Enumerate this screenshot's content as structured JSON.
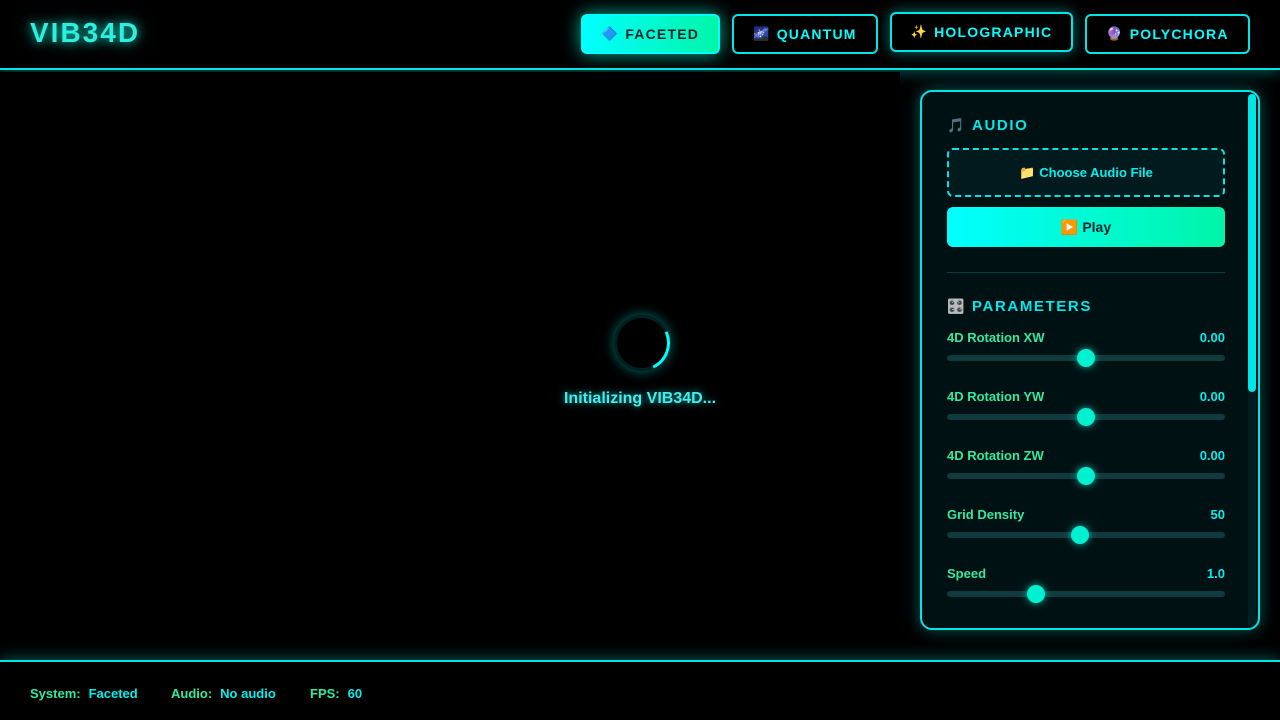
{
  "app": {
    "title": "VIB34D"
  },
  "systems": [
    {
      "icon": "🔷",
      "icon_name": "diamond-icon",
      "label": "FACETED",
      "active": true
    },
    {
      "icon": "🌌",
      "icon_name": "galaxy-icon",
      "label": "QUANTUM",
      "active": false
    },
    {
      "icon": "✨",
      "icon_name": "sparkles-icon",
      "label": "HOLOGRAPHIC",
      "active": false
    },
    {
      "icon": "🔮",
      "icon_name": "crystal-ball-icon",
      "label": "POLYCHORA",
      "active": false
    }
  ],
  "stage": {
    "loading_text": "Initializing VIB34D..."
  },
  "panel": {
    "audio": {
      "icon": "🎵",
      "icon_name": "music-note-icon",
      "title": "AUDIO",
      "file_icon": "📁",
      "file_label": "Choose Audio File",
      "play_icon": "▶️",
      "play_label": "Play"
    },
    "parameters": {
      "icon": "🎛️",
      "icon_name": "control-knobs-icon",
      "title": "PARAMETERS",
      "items": [
        {
          "label": "4D Rotation XW",
          "value": "0.00",
          "level": 0.5
        },
        {
          "label": "4D Rotation YW",
          "value": "0.00",
          "level": 0.5
        },
        {
          "label": "4D Rotation ZW",
          "value": "0.00",
          "level": 0.5
        },
        {
          "label": "Grid Density",
          "value": "50",
          "level": 0.48
        },
        {
          "label": "Speed",
          "value": "1.0",
          "level": 0.32
        }
      ]
    },
    "scroll_fraction": 0.56
  },
  "status": {
    "system_label": "System:",
    "system_value": "Faceted",
    "audio_label": "Audio:",
    "audio_value": "No audio",
    "fps_label": "FPS:",
    "fps_value": "60"
  },
  "colors": {
    "accent": "#00ffff",
    "accent_green": "#00f5a8",
    "label_green": "#33e9a0",
    "background": "#000000"
  }
}
